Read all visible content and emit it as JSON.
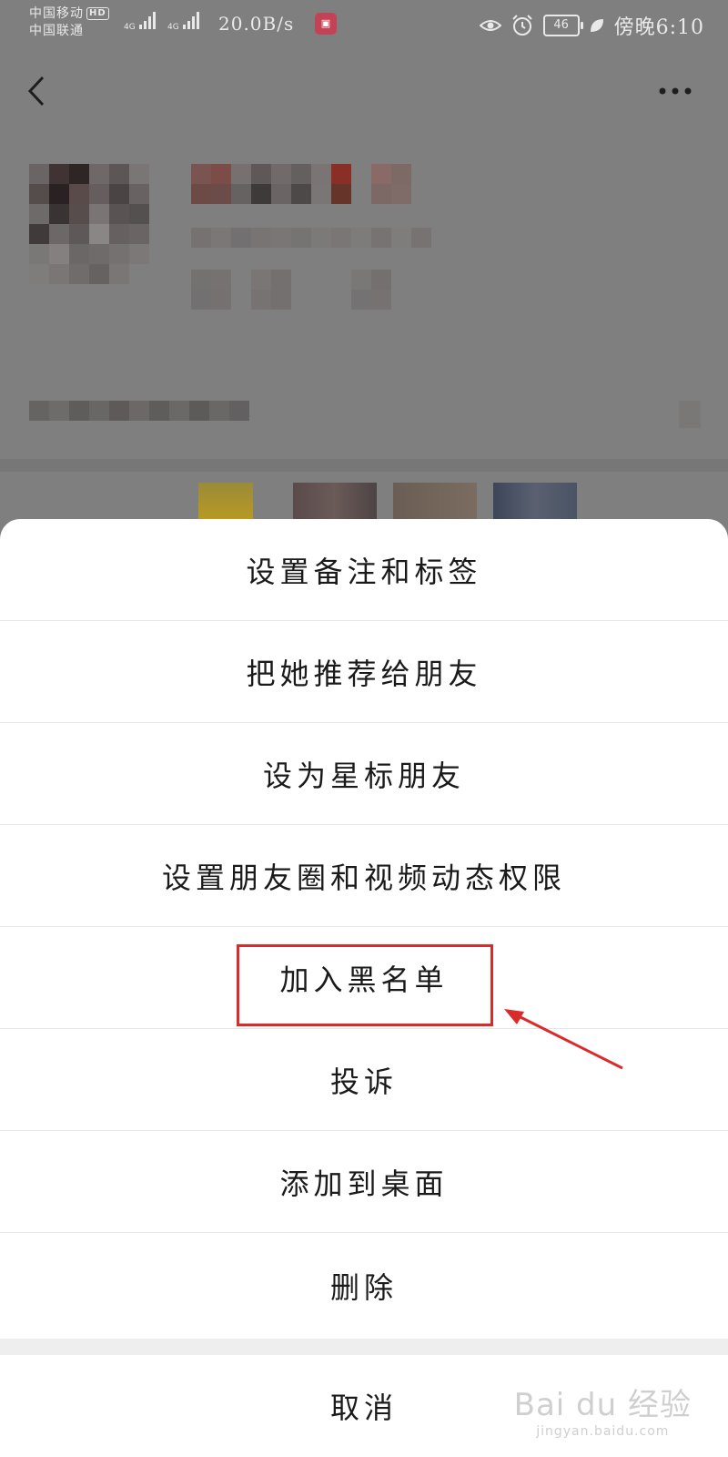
{
  "status_bar": {
    "carrier_1": "中国移动",
    "hd_badge": "HD",
    "carrier_2": "中国联通",
    "network_1": "4G",
    "network_2": "4G",
    "net_speed": "20.0B/s",
    "battery": "46",
    "time": "傍晚6:10"
  },
  "menu": {
    "items": [
      {
        "label": "设置备注和标签"
      },
      {
        "label": "把她推荐给朋友"
      },
      {
        "label": "设为星标朋友"
      },
      {
        "label": "设置朋友圈和视频动态权限"
      },
      {
        "label": "加入黑名单"
      },
      {
        "label": "投诉"
      },
      {
        "label": "添加到桌面"
      },
      {
        "label": "删除"
      }
    ],
    "cancel": "取消"
  },
  "watermark": {
    "logo": "Bai du 经验",
    "url": "jingyan.baidu.com"
  },
  "colors": {
    "highlight": "#d92b2b",
    "overlay": "#7f7f7f"
  }
}
